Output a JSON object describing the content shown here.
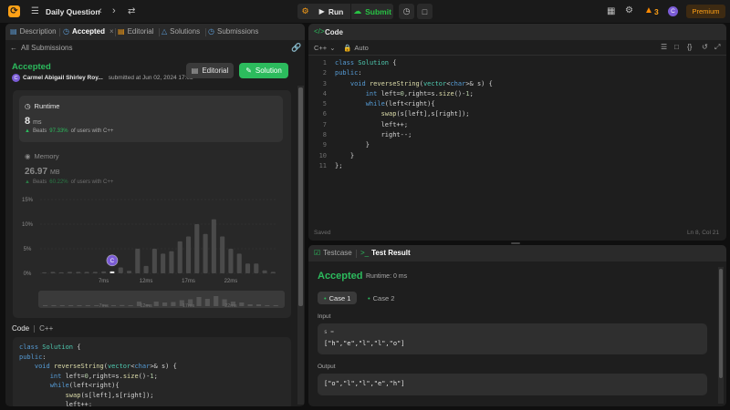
{
  "topbar": {
    "title": "Daily Question",
    "run_label": "Run",
    "submit_label": "Submit",
    "streak_count": "3",
    "avatar_initial": "C",
    "premium_label": "Premium"
  },
  "left_tabs": [
    {
      "label": "Description"
    },
    {
      "label": "Accepted"
    },
    {
      "label": "Editorial"
    },
    {
      "label": "Solutions"
    },
    {
      "label": "Submissions"
    }
  ],
  "submission": {
    "back_label": "All Submissions",
    "status": "Accepted",
    "user": "Carmel Abigail Shirley Roy...",
    "submitted_at": "submitted at Jun 02, 2024 17:08",
    "editorial_label": "Editorial",
    "solution_label": "Solution"
  },
  "runtime": {
    "title": "Runtime",
    "value": "8",
    "unit": "ms",
    "beats_prefix": "Beats",
    "beats_pct": "97.33%",
    "beats_suffix": "of users with C++"
  },
  "memory": {
    "title": "Memory",
    "value": "26.97",
    "unit": "MB",
    "beats_prefix": "Beats",
    "beats_pct": "60.22%",
    "beats_suffix": "of users with C++"
  },
  "chart_data": {
    "type": "bar",
    "y_ticks": [
      "15%",
      "10%",
      "5%",
      "0%"
    ],
    "ylim": [
      0,
      15
    ],
    "x_ticks": [
      "7ms",
      "12ms",
      "17ms",
      "22ms"
    ],
    "values": [
      0.2,
      0.3,
      0.2,
      0.3,
      0.3,
      0.3,
      0.3,
      0.4,
      0.4,
      1.2,
      0.5,
      5.0,
      1.5,
      5.0,
      4.0,
      4.5,
      6.5,
      7.5,
      10.0,
      8.0,
      11.0,
      7.5,
      5.0,
      4.0,
      2.0,
      2.0,
      0.6,
      0.3
    ],
    "highlight_index": 8,
    "marker_label": "C"
  },
  "code_section": {
    "label": "Code",
    "language": "C++"
  },
  "editor": {
    "title": "Code",
    "language": "C++",
    "auto_label": "Auto",
    "saved_label": "Saved",
    "cursor_pos": "Ln 8, Col 21",
    "line_numbers": [
      "1",
      "2",
      "3",
      "4",
      "5",
      "6",
      "7",
      "8",
      "9",
      "10",
      "11"
    ]
  },
  "bottom": {
    "testcase_tab": "Testcase",
    "result_tab": "Test Result",
    "status": "Accepted",
    "runtime": "Runtime: 0 ms",
    "cases": [
      "Case 1",
      "Case 2"
    ],
    "input_label": "Input",
    "input_var": "s =",
    "input_value": "[\"h\",\"e\",\"l\",\"l\",\"o\"]",
    "output_label": "Output",
    "output_value": "[\"o\",\"l\",\"l\",\"e\",\"h\"]"
  },
  "colors": {
    "accent_green": "#2cbb5d",
    "brand_orange": "#ffa116",
    "bg": "#0f0f0f",
    "panel": "#1e1e1e"
  }
}
